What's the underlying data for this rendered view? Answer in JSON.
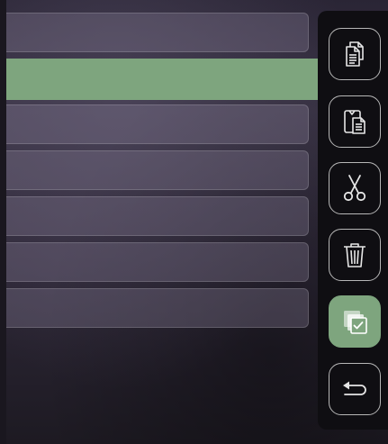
{
  "list": {
    "rows": [
      {
        "selected": false
      },
      {
        "selected": true
      },
      {
        "selected": false
      },
      {
        "selected": false
      },
      {
        "selected": false
      },
      {
        "selected": false
      },
      {
        "selected": false
      }
    ],
    "selected_color": "#7ea57e"
  },
  "dock": {
    "buttons": [
      {
        "icon": "copy-icon",
        "active": false
      },
      {
        "icon": "paste-icon",
        "active": false
      },
      {
        "icon": "scissors-icon",
        "active": false
      },
      {
        "icon": "trash-icon",
        "active": false
      },
      {
        "icon": "select-all-icon",
        "active": true
      },
      {
        "icon": "back-icon",
        "active": false
      }
    ],
    "active_color": "#7ea57e"
  }
}
